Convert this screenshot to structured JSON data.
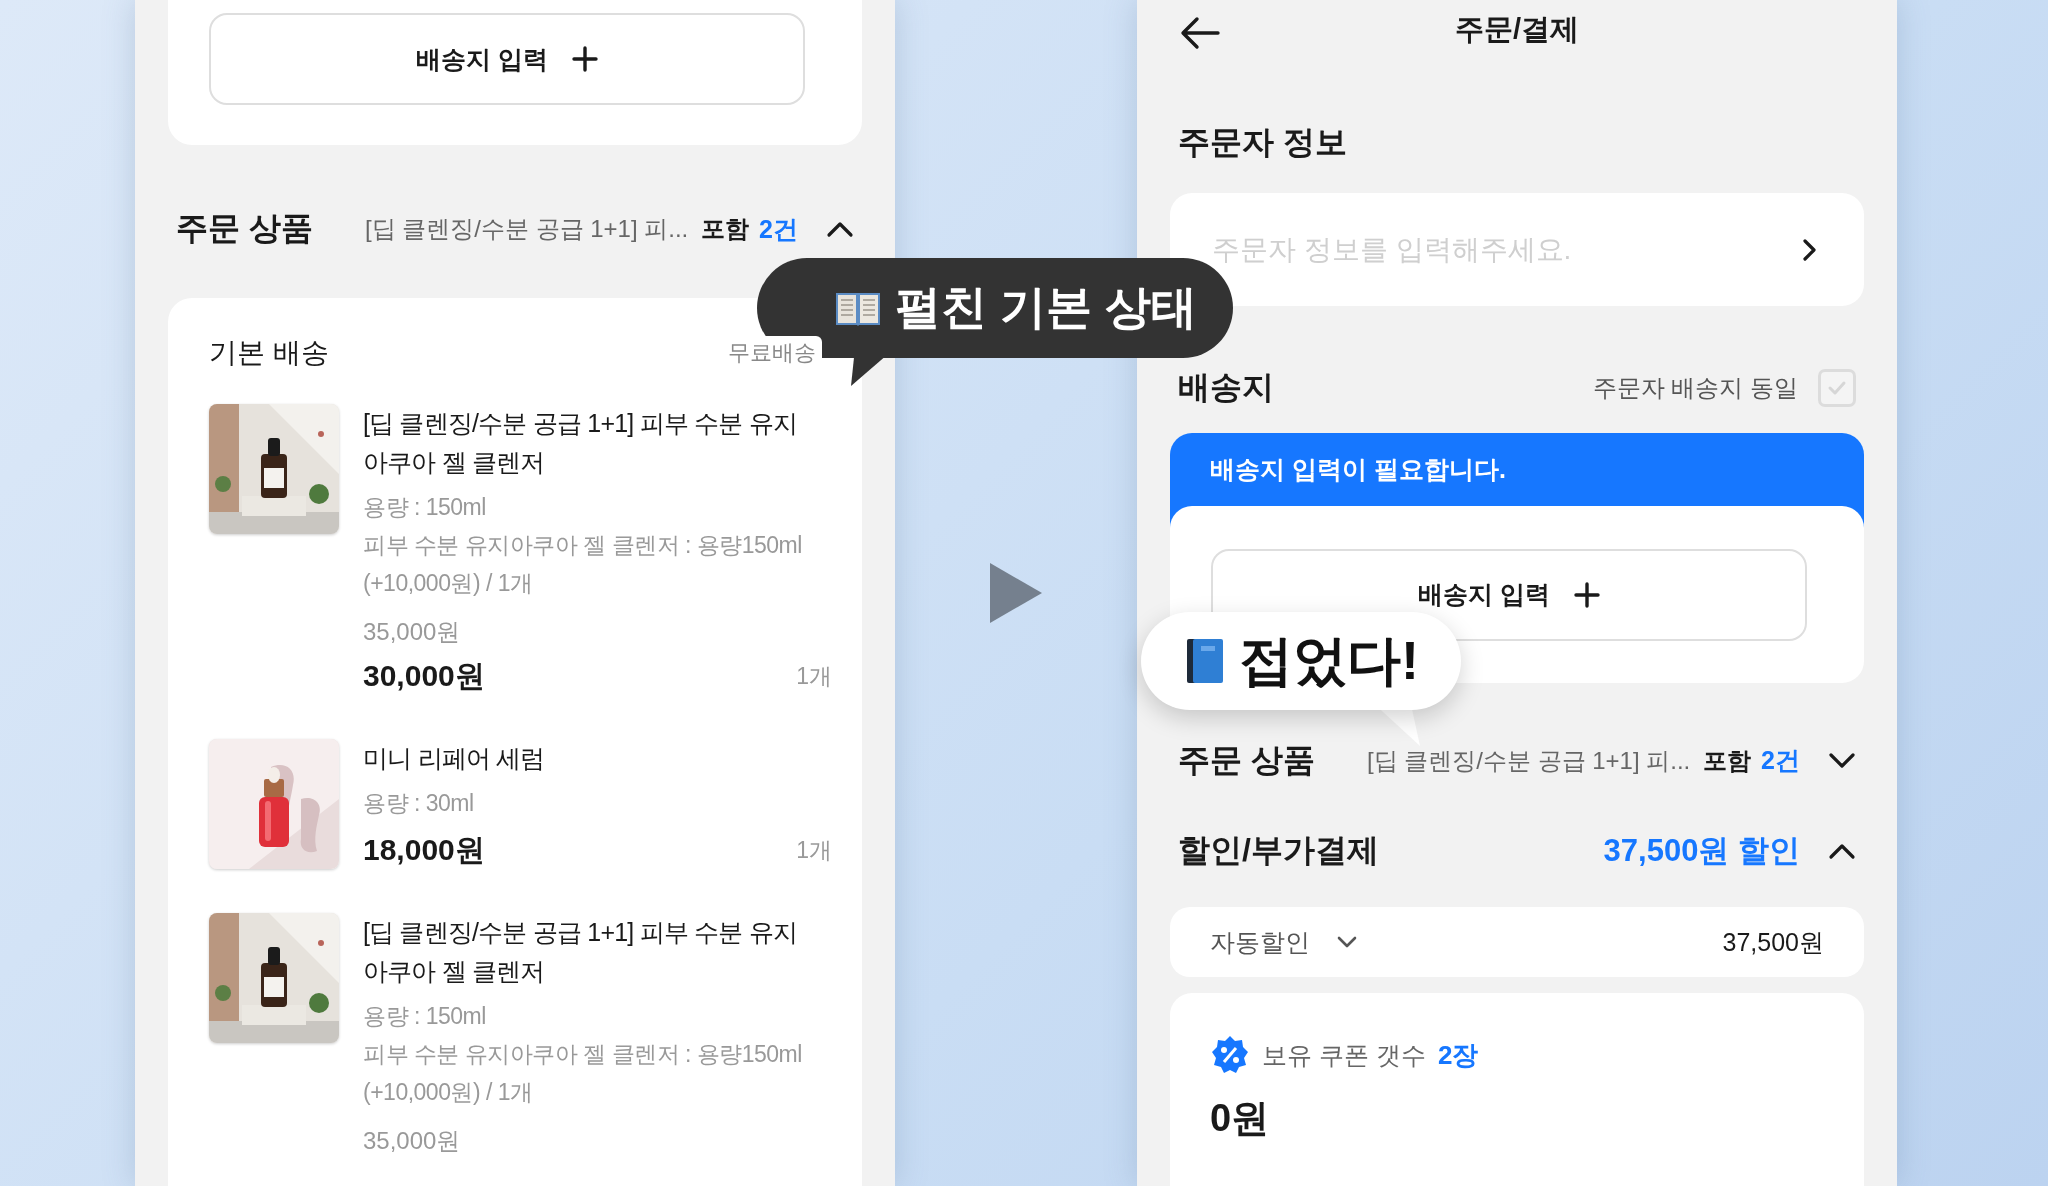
{
  "left_panel": {
    "address_button": "배송지 입력",
    "order_products": {
      "title": "주문 상품",
      "summary": "[딥 클렌징/수분 공급 1+1] 피...",
      "include_label": "포함",
      "count": "2건",
      "expanded": true
    },
    "shipping_group": {
      "title": "기본 배송",
      "fee": "무료배송"
    },
    "items": [
      {
        "image": {
          "kind": "picture"
        },
        "title": "[딥 클렌징/수분 공급 1+1] 피부 수분 유지 아쿠아 젤 클렌저",
        "options": [
          "용량 : 150ml",
          "피부 수분 유지아쿠아 젤 클렌저 : 용량150ml (+10,000원) / 1개"
        ],
        "original_price": "35,000원",
        "price": "30,000원",
        "quantity": "1개"
      },
      {
        "image": {
          "kind": "picture"
        },
        "title": "미니 리페어 세럼",
        "options": [
          "용량 : 30ml"
        ],
        "price": "18,000원",
        "quantity": "1개"
      },
      {
        "image": {
          "kind": "picture"
        },
        "title": "[딥 클렌징/수분 공급 1+1] 피부 수분 유지 아쿠아 젤 클렌저",
        "options": [
          "용량 : 150ml",
          "피부 수분 유지아쿠아 젤 클렌저 : 용량150ml (+10,000원) / 1개"
        ],
        "original_price": "35,000원"
      }
    ]
  },
  "right_panel": {
    "title": "주문/결제",
    "orderer": {
      "title": "주문자 정보",
      "placeholder": "주문자 정보를 입력해주세요."
    },
    "shipping": {
      "title": "배송지",
      "same_as_orderer_label": "주문자 배송지 동일",
      "same_as_orderer_checked": false,
      "alert": "배송지 입력이 필요합니다.",
      "address_button": "배송지 입력"
    },
    "order_products": {
      "title": "주문 상품",
      "summary": "[딥 클렌징/수분 공급 1+1] 피...",
      "include_label": "포함",
      "count": "2건",
      "expanded": false
    },
    "discount": {
      "title": "할인/부가결제",
      "total": "37,500원 할인",
      "expanded": true,
      "auto_discount": {
        "label": "자동할인",
        "amount": "37,500원"
      },
      "coupon": {
        "label": "보유 쿠폰 갯수",
        "count": "2장",
        "amount": "0원"
      }
    }
  },
  "callouts": [
    {
      "kind": "open",
      "text": "펼친 기본 상태"
    },
    {
      "kind": "closed",
      "text": "접었다!"
    }
  ]
}
